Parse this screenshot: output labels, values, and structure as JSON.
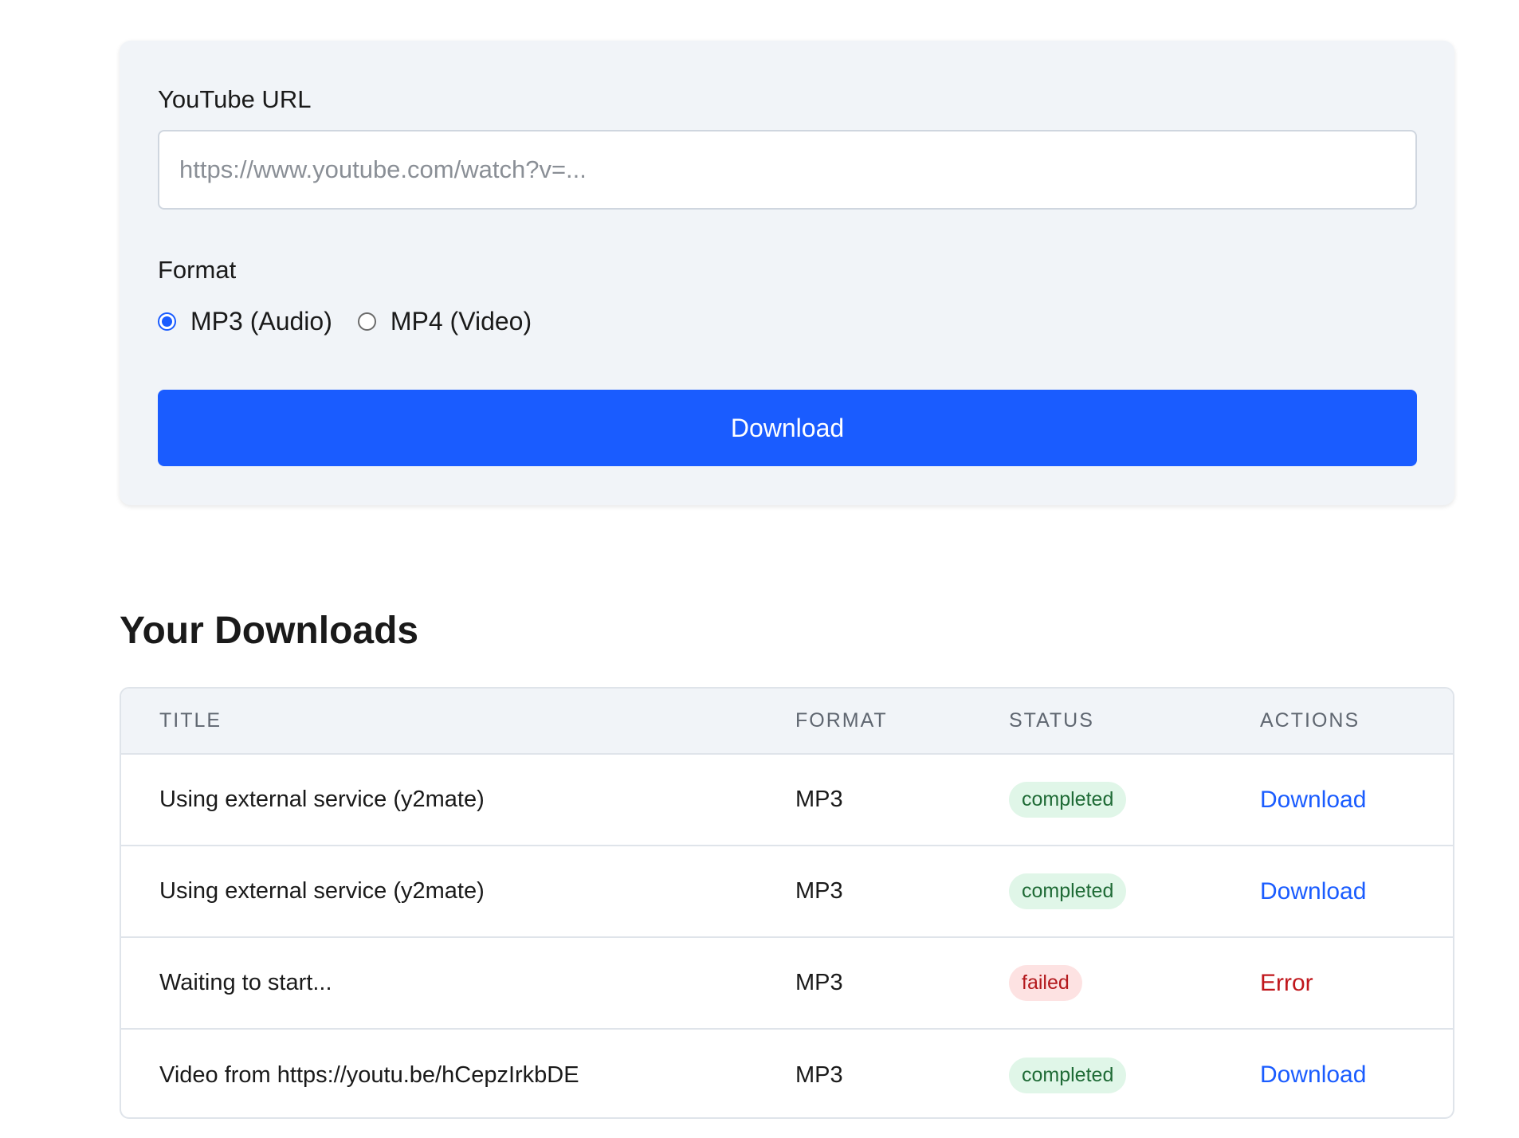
{
  "form": {
    "url_label": "YouTube URL",
    "url_placeholder": "https://www.youtube.com/watch?v=...",
    "url_value": "",
    "format_label": "Format",
    "format_options": [
      {
        "label": "MP3 (Audio)",
        "checked": true
      },
      {
        "label": "MP4 (Video)",
        "checked": false
      }
    ],
    "submit_label": "Download"
  },
  "downloads": {
    "title": "Your Downloads",
    "columns": [
      "TITLE",
      "FORMAT",
      "STATUS",
      "ACTIONS"
    ],
    "rows": [
      {
        "title": "Using external service (y2mate)",
        "format": "MP3",
        "status": "completed",
        "action": "Download"
      },
      {
        "title": "Using external service (y2mate)",
        "format": "MP3",
        "status": "completed",
        "action": "Download"
      },
      {
        "title": "Waiting to start...",
        "format": "MP3",
        "status": "failed",
        "action": "Error"
      },
      {
        "title": "Video from https://youtu.be/hCepzIrkbDE",
        "format": "MP3",
        "status": "completed",
        "action": "Download"
      }
    ]
  },
  "colors": {
    "accent": "#1a5cff",
    "completed_bg": "#e0f6e8",
    "completed_text": "#1f6b36",
    "failed_bg": "#fde2e2",
    "failed_text": "#b3181c",
    "error_text": "#c0161b"
  }
}
